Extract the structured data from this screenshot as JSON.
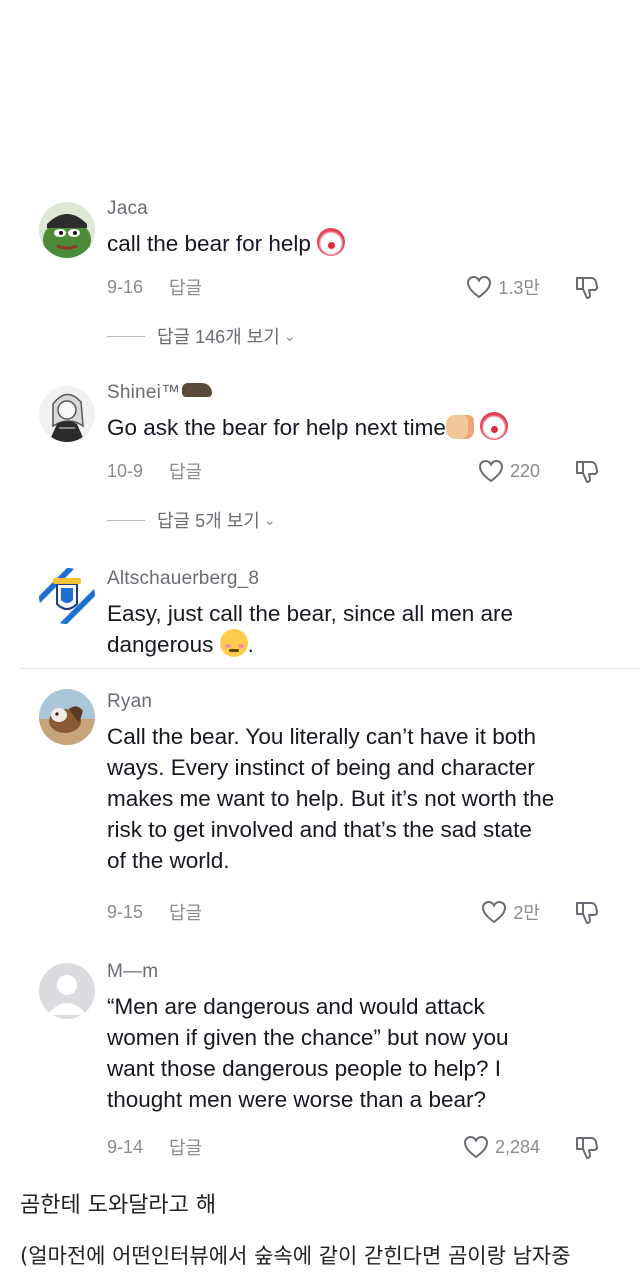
{
  "comments": [
    {
      "username": "Jaca",
      "text": "call the bear for help",
      "emoji": [
        "clown-face"
      ],
      "date": "9-16",
      "reply_label": "답글",
      "likes": "1.3만",
      "view_replies": "답글 146개 보기"
    },
    {
      "username": "Shinei™",
      "username_emoji": "bear",
      "text": "Go ask the bear for help next time",
      "emoji": [
        "fist",
        "clown-face"
      ],
      "date": "10-9",
      "reply_label": "답글",
      "likes": "220",
      "view_replies": "답글 5개 보기"
    },
    {
      "username": "Altschauerberg_8",
      "text_line1": "Easy, just call the bear, since all men are",
      "text_line2": "dangerous",
      "text_trail": ".",
      "emoji": [
        "smiling-face-with-hearts"
      ]
    },
    {
      "username": "Ryan",
      "lines": [
        "Call the bear. You literally can’t have it both",
        "ways. Every instinct of being and character",
        "makes me want to help. But it’s not worth the",
        "risk to get involved and that’s the sad state",
        "of the world."
      ],
      "date": "9-15",
      "reply_label": "답글",
      "likes": "2만"
    },
    {
      "username": "M—m",
      "lines": [
        "“Men are dangerous and would attack",
        "women if given the chance” but now you",
        "want those dangerous people to help? I",
        "thought men were worse than a bear?"
      ],
      "date": "9-14",
      "reply_label": "답글",
      "likes": "2,284"
    }
  ],
  "caption": {
    "line1": "곰한테 도와달라고 해",
    "line2": "(얼마전에 어떤인터뷰에서 숲속에 같이 갇힌다면 곰이랑 남자중"
  },
  "icons": {
    "like": "heart-outline-icon",
    "dislike": "thumbs-down-outline-icon",
    "expand": "chevron-down-icon"
  },
  "colors": {
    "text": "#161823",
    "muted": "#8a8b91",
    "username": "#6b6b73"
  }
}
